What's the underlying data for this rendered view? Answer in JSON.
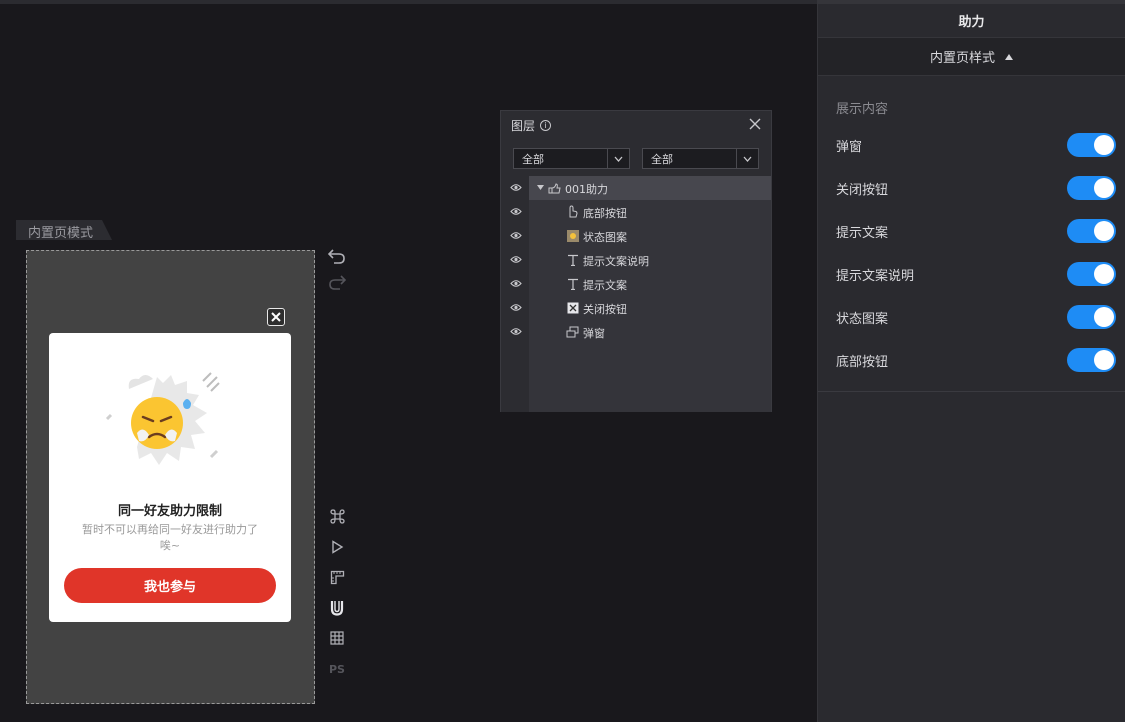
{
  "canvas": {
    "mode_tab": "内置页模式",
    "popup": {
      "title": "同一好友助力限制",
      "desc": "暂时不可以再给同一好友进行助力了唉~",
      "button": "我也参与"
    },
    "tools": [
      "command-icon",
      "play-icon",
      "ruler-icon",
      "magnet-icon",
      "grid-icon",
      "ps-icon"
    ],
    "ps_label": "PS"
  },
  "layers_panel": {
    "title": "图层",
    "filter_1": "全部",
    "filter_2": "全部",
    "group": "001助力",
    "items": [
      {
        "label": "底部按钮",
        "icon": "pointer-icon"
      },
      {
        "label": "状态图案",
        "icon": "image-icon"
      },
      {
        "label": "提示文案说明",
        "icon": "text-icon"
      },
      {
        "label": "提示文案",
        "icon": "text-icon"
      },
      {
        "label": "关闭按钮",
        "icon": "close-box-icon"
      },
      {
        "label": "弹窗",
        "icon": "layers-icon"
      }
    ]
  },
  "right_panel": {
    "title": "助力",
    "section": "内置页样式",
    "content_title": "展示内容",
    "options": [
      {
        "label": "弹窗",
        "on": true
      },
      {
        "label": "关闭按钮",
        "on": true
      },
      {
        "label": "提示文案",
        "on": true
      },
      {
        "label": "提示文案说明",
        "on": true
      },
      {
        "label": "状态图案",
        "on": true
      },
      {
        "label": "底部按钮",
        "on": true
      }
    ]
  },
  "colors": {
    "accent": "#1e8cf5",
    "cta": "#e03529"
  }
}
